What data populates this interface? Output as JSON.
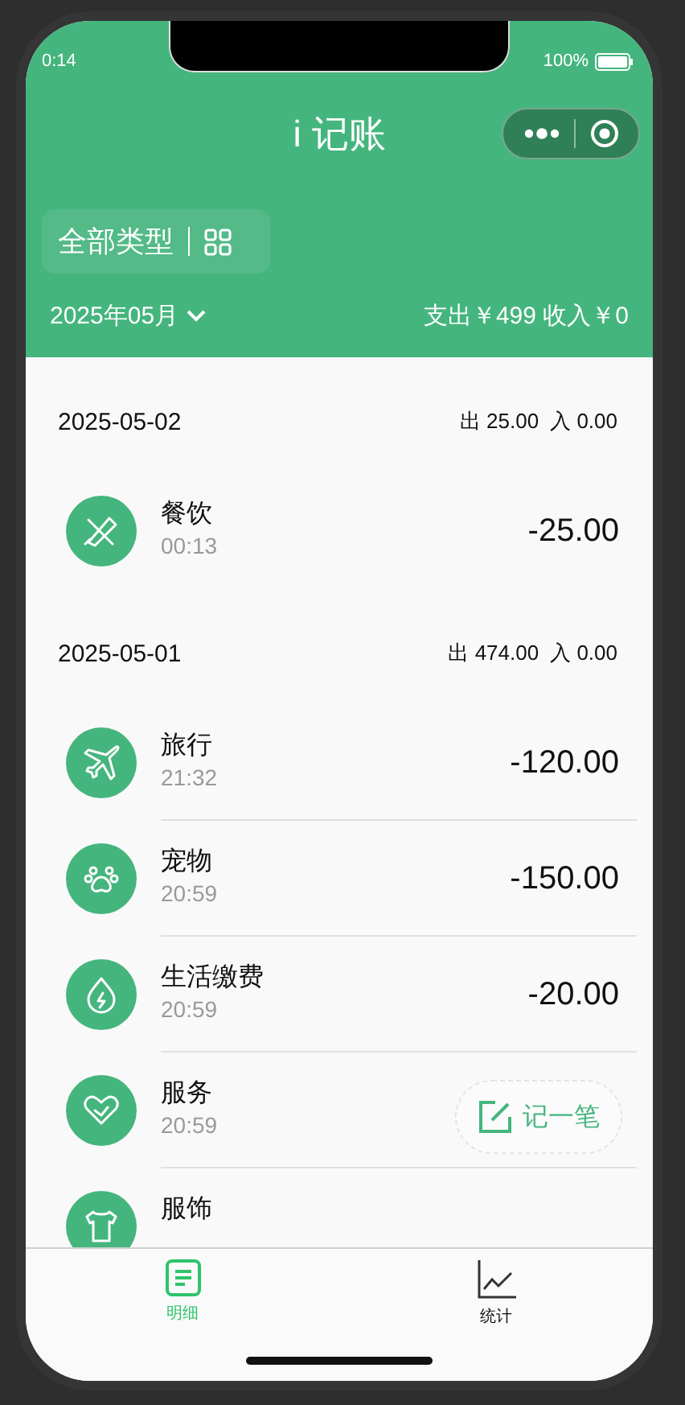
{
  "status_bar": {
    "time": "0:14",
    "battery": "100%"
  },
  "header": {
    "title": "i 记账"
  },
  "filter": {
    "label": "全部类型"
  },
  "summary": {
    "month": "2025年05月",
    "totals": "支出￥499 收入￥0"
  },
  "groups": [
    {
      "date": "2025-05-02",
      "expense": "出 25.00",
      "income": "入 0.00",
      "items": [
        {
          "kind": "dining",
          "category": "餐饮",
          "time": "00:13",
          "amount": "-25.00"
        }
      ]
    },
    {
      "date": "2025-05-01",
      "expense": "出 474.00",
      "income": "入 0.00",
      "items": [
        {
          "kind": "travel",
          "category": "旅行",
          "time": "21:32",
          "amount": "-120.00"
        },
        {
          "kind": "pet",
          "category": "宠物",
          "time": "20:59",
          "amount": "-150.00"
        },
        {
          "kind": "utility",
          "category": "生活缴费",
          "time": "20:59",
          "amount": "-20.00"
        },
        {
          "kind": "service",
          "category": "服务",
          "time": "20:59"
        },
        {
          "kind": "clothing",
          "category": "服饰"
        }
      ]
    }
  ],
  "fab": {
    "label": "记一笔"
  },
  "tabs": [
    {
      "kind": "list",
      "label": "明细",
      "selected": true
    },
    {
      "kind": "chart",
      "label": "统计",
      "selected": false
    }
  ]
}
